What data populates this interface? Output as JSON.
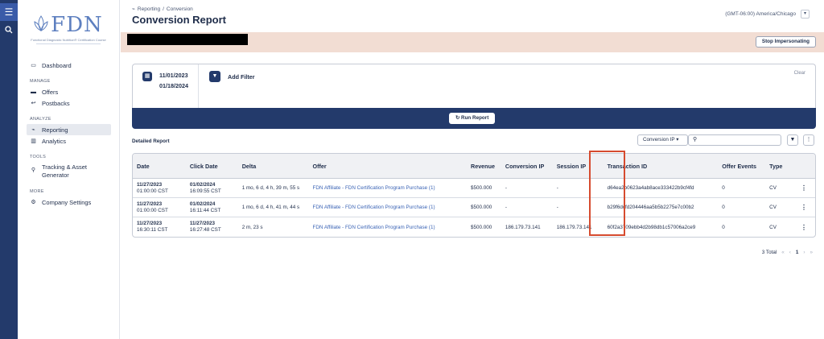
{
  "brand": {
    "wordmark": "FDN",
    "tagline": "Functional Diagnostic Nutrition® Certification Course"
  },
  "nav": {
    "dashboard": "Dashboard",
    "manage_header": "MANAGE",
    "offers": "Offers",
    "postbacks": "Postbacks",
    "analyze_header": "ANALYZE",
    "reporting": "Reporting",
    "analytics": "Analytics",
    "tools_header": "TOOLS",
    "tracking_line1": "Tracking & Asset",
    "tracking_line2": "Generator",
    "more_header": "MORE",
    "company_settings": "Company Settings"
  },
  "breadcrumb": {
    "parent": "Reporting",
    "separator": "/",
    "current": "Conversion"
  },
  "page_title": "Conversion Report",
  "timezone": "(GMT-06:00) America/Chicago",
  "banner": {
    "stop_label": "Stop Impersonating"
  },
  "filter": {
    "start_date": "11/01/2023",
    "end_date": "01/18/2024",
    "add_filter": "Add Filter",
    "clear": "Clear",
    "run_report": "Run Report"
  },
  "report": {
    "title": "Detailed Report",
    "search_by": "Conversion IP",
    "search_placeholder": ""
  },
  "columns": [
    "Date",
    "Click Date",
    "Delta",
    "Offer",
    "Revenue",
    "Conversion IP",
    "Session IP",
    "Transaction ID",
    "Offer Events",
    "Type"
  ],
  "rows": [
    {
      "date": "11/27/2023",
      "date_time": "01:00:00 CST",
      "click_date": "01/02/2024",
      "click_time": "16:09:55 CST",
      "delta": "1 mo, 6 d, 4 h, 39 m, 55 s",
      "offer": "FDN Affiliate - FDN Certification Program Purchase (1)",
      "revenue": "$500.000",
      "conversion_ip": "-",
      "session_ip": "-",
      "transaction_id": "d64ea2b0623a4ab8ace333422b9cf4fd",
      "offer_events": "0",
      "type": "CV"
    },
    {
      "date": "11/27/2023",
      "date_time": "01:00:00 CST",
      "click_date": "01/02/2024",
      "click_time": "16:11:44 CST",
      "delta": "1 mo, 6 d, 4 h, 41 m, 44 s",
      "offer": "FDN Affiliate - FDN Certification Program Purchase (1)",
      "revenue": "$500.000",
      "conversion_ip": "-",
      "session_ip": "-",
      "transaction_id": "b29f6dcfd204446aa5b5b2275e7c00b2",
      "offer_events": "0",
      "type": "CV"
    },
    {
      "date": "11/27/2023",
      "date_time": "16:30:11 CST",
      "click_date": "11/27/2023",
      "click_time": "16:27:48 CST",
      "delta": "2 m, 23 s",
      "offer": "FDN Affiliate - FDN Certification Program Purchase (1)",
      "revenue": "$500.000",
      "conversion_ip": "186.179.73.141",
      "session_ip": "186.179.73.141",
      "transaction_id": "60f2a3709ebb4d2b98db1c57006a2ce9",
      "offer_events": "0",
      "type": "CV"
    }
  ],
  "pagination": {
    "total": "3 Total",
    "page": "1"
  },
  "colors": {
    "rail": "#233a6b",
    "banner": "#f2ddd3",
    "accent_box": "#d64b2f",
    "link": "#3a63b5"
  }
}
